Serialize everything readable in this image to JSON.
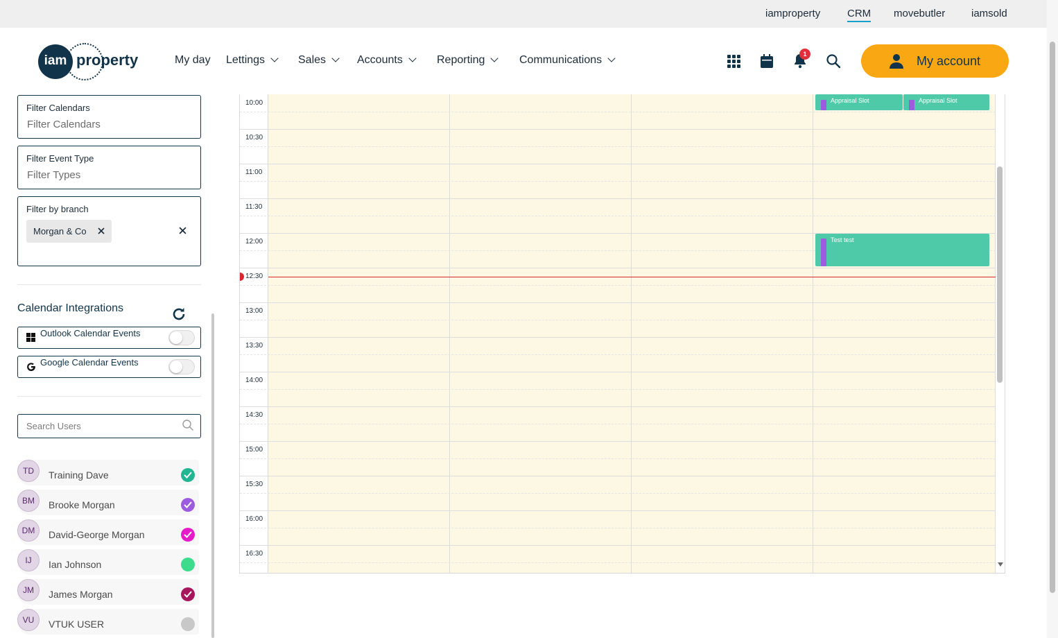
{
  "top_links": [
    "iamproperty",
    "CRM",
    "movebutler",
    "iamsold"
  ],
  "logo": {
    "circle_text": "iam",
    "word": "property"
  },
  "nav": [
    "My day",
    "Lettings",
    "Sales",
    "Accounts",
    "Reporting",
    "Communications"
  ],
  "header": {
    "notification_count": "1",
    "my_account_label": "My account"
  },
  "filters": {
    "calendars": {
      "label": "Filter Calendars",
      "placeholder": "Filter Calendars"
    },
    "event_type": {
      "label": "Filter Event Type",
      "placeholder": "Filter Types"
    },
    "branch": {
      "label": "Filter by branch",
      "chip": "Morgan & Co"
    }
  },
  "integrations": {
    "title": "Calendar Integrations",
    "outlook": "Outlook Calendar Events",
    "google": "Google Calendar Events"
  },
  "search_users": {
    "placeholder": "Search Users"
  },
  "users": [
    {
      "initials": "TD",
      "name": "Training Dave",
      "color": "#21b592",
      "checked": true
    },
    {
      "initials": "BM",
      "name": "Brooke Morgan",
      "color": "#9d5ce0",
      "checked": true
    },
    {
      "initials": "DM",
      "name": "David-George Morgan",
      "color": "#e61bc8",
      "checked": true
    },
    {
      "initials": "IJ",
      "name": "Ian Johnson",
      "color": "#3ddc8c",
      "checked": false
    },
    {
      "initials": "JM",
      "name": "James Morgan",
      "color": "#a8175e",
      "checked": true
    },
    {
      "initials": "VU",
      "name": "VTUK USER",
      "color": "#c8c8c8",
      "checked": false
    }
  ],
  "calendar": {
    "times": [
      "10:00",
      "10:30",
      "11:00",
      "11:30",
      "12:00",
      "12:30",
      "13:00",
      "13:30",
      "14:00",
      "14:30",
      "15:00",
      "15:30",
      "16:00",
      "16:30"
    ],
    "events": [
      {
        "title": "Appraisal Slot"
      },
      {
        "title": "Appraisal Slot"
      },
      {
        "title": "Test test"
      }
    ]
  },
  "colors": {
    "accent": "#f9a814",
    "brand": "#12344a",
    "event": "#4fcaa8",
    "now_line": "#d8262b"
  }
}
